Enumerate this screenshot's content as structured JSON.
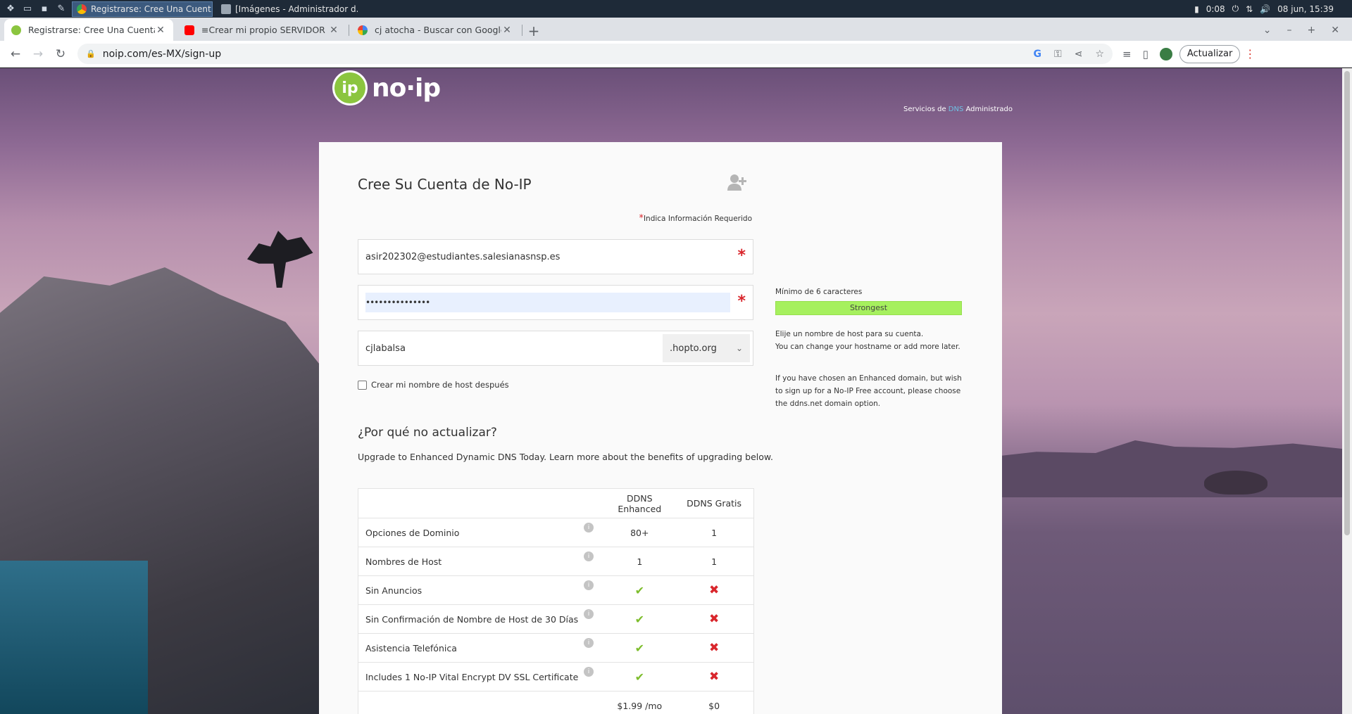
{
  "taskbar": {
    "tasks": [
      {
        "label": "Registrarse: Cree Una Cuent...",
        "active": true
      },
      {
        "label": "[Imágenes - Administrador d...",
        "active": false
      }
    ],
    "battery": "0:08",
    "clock": "08 jun, 15:39"
  },
  "browser": {
    "tabs": [
      {
        "title": "Registrarse: Cree Una Cuenta d",
        "active": true
      },
      {
        "title": "≡Crear mi propio SERVIDOR W",
        "active": false
      },
      {
        "title": "cj atocha - Buscar con Google",
        "active": false
      }
    ],
    "url": "noip.com/es-MX/sign-up",
    "update_label": "Actualizar"
  },
  "header": {
    "logo_text": "no·ip",
    "tagline_prefix": "Servicios de ",
    "tagline_dns": "DNS",
    "tagline_suffix": " Administrado"
  },
  "form": {
    "title": "Cree Su Cuenta de No-IP",
    "required_note": "Indica Información Requerido",
    "email_value": "asir202302@estudiantes.salesianasnsp.es",
    "password_mask": "•••••••••••••••",
    "hostname_value": "cjlabalsa",
    "domain_value": ".hopto.org",
    "later_checkbox_label": "Crear mi nombre de host después",
    "pwd_min_help": "Mínimo de 6 caracteres",
    "strength_label": "Strongest",
    "host_help_1": "Elije un nombre de host para su cuenta.",
    "host_help_2": "You can change your hostname or add more later.",
    "enhanced_help": "If you have chosen an Enhanced domain, but wish to sign up for a No-IP Free account, please choose the ddns.net domain option."
  },
  "upgrade": {
    "title": "¿Por qué no actualizar?",
    "subtitle": "Upgrade to Enhanced Dynamic DNS Today. Learn more about the benefits of upgrading below.",
    "col_enhanced": "DDNS Enhanced",
    "col_free": "DDNS Gratis",
    "rows": [
      {
        "feature": "Opciones de Dominio",
        "enhanced": "80+",
        "free": "1"
      },
      {
        "feature": "Nombres de Host",
        "enhanced": "1",
        "free": "1"
      },
      {
        "feature": "Sin Anuncios",
        "enhanced": "✔",
        "free": "✖"
      },
      {
        "feature": "Sin Confirmación de Nombre de Host de 30 Días",
        "enhanced": "✔",
        "free": "✖"
      },
      {
        "feature": "Asistencia Telefónica",
        "enhanced": "✔",
        "free": "✖"
      },
      {
        "feature": "Includes 1 No-IP Vital Encrypt DV SSL Certificate",
        "enhanced": "✔",
        "free": "✖"
      }
    ],
    "price_enhanced": "$1.99 /mo",
    "price_free": "$0"
  }
}
